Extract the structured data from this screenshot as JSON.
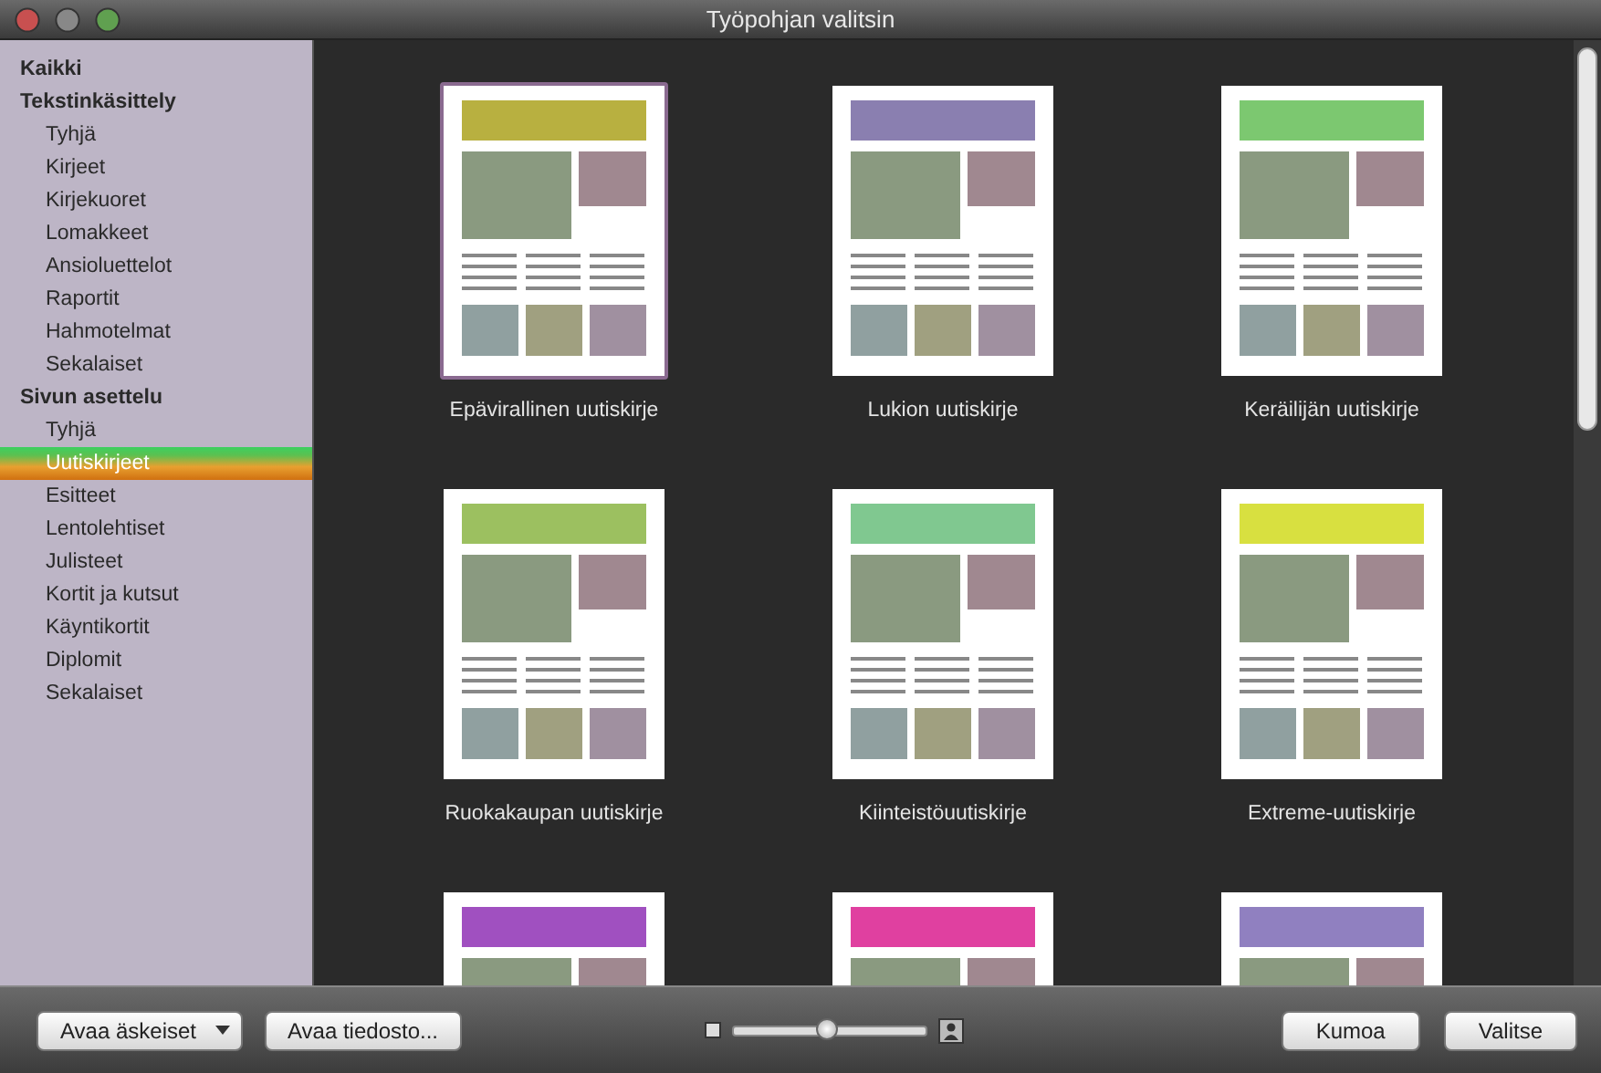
{
  "window": {
    "title": "Työpohjan valitsin"
  },
  "sidebar": {
    "items": [
      {
        "label": "Kaikki",
        "selected": false
      },
      {
        "label": "Tekstinkäsittely",
        "selected": false,
        "children": [
          {
            "label": "Tyhjä",
            "selected": false
          },
          {
            "label": "Kirjeet",
            "selected": false
          },
          {
            "label": "Kirjekuoret",
            "selected": false
          },
          {
            "label": "Lomakkeet",
            "selected": false
          },
          {
            "label": "Ansioluettelot",
            "selected": false
          },
          {
            "label": "Raportit",
            "selected": false
          },
          {
            "label": "Hahmotelmat",
            "selected": false
          },
          {
            "label": "Sekalaiset",
            "selected": false
          }
        ]
      },
      {
        "label": "Sivun asettelu",
        "selected": false,
        "children": [
          {
            "label": "Tyhjä",
            "selected": false
          },
          {
            "label": "Uutiskirjeet",
            "selected": true
          },
          {
            "label": "Esitteet",
            "selected": false
          },
          {
            "label": "Lentolehtiset",
            "selected": false
          },
          {
            "label": "Julisteet",
            "selected": false
          },
          {
            "label": "Kortit ja kutsut",
            "selected": false
          },
          {
            "label": "Käyntikortit",
            "selected": false
          },
          {
            "label": "Diplomit",
            "selected": false
          },
          {
            "label": "Sekalaiset",
            "selected": false
          }
        ]
      }
    ]
  },
  "templates": [
    {
      "caption": "Epävirallinen uutiskirje",
      "selected": true,
      "color": "#b8b040"
    },
    {
      "caption": "Lukion uutiskirje",
      "selected": false,
      "color": "#8a7fb0"
    },
    {
      "caption": "Keräilijän uutiskirje",
      "selected": false,
      "color": "#7cc870"
    },
    {
      "caption": "Ruokakaupan uutiskirje",
      "selected": false,
      "color": "#9cc060"
    },
    {
      "caption": "Kiinteistöuutiskirje",
      "selected": false,
      "color": "#80c890"
    },
    {
      "caption": "Extreme-uutiskirje",
      "selected": false,
      "color": "#d8e040"
    },
    {
      "selected": false,
      "color": "#a050c0"
    },
    {
      "selected": false,
      "color": "#e040a0"
    },
    {
      "selected": false,
      "color": "#9080c0"
    }
  ],
  "footer": {
    "buttons": [
      {
        "label": "Avaa äskeiset",
        "kind": "menu"
      },
      {
        "label": "Avaa tiedosto...",
        "kind": "plain"
      }
    ],
    "zoom_slider": {
      "level": 0.48
    },
    "actions": [
      {
        "label": "Kumoa"
      },
      {
        "label": "Valitse"
      }
    ]
  }
}
